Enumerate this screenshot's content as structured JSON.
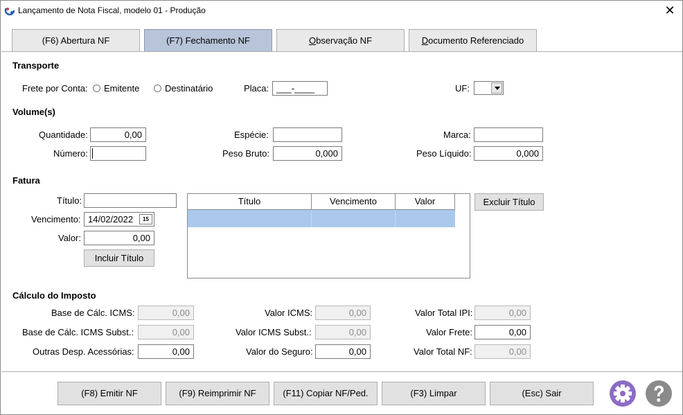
{
  "window": {
    "title": "Lançamento de Nota Fiscal, modelo 01 - Produção",
    "close": "✕"
  },
  "tabs": [
    {
      "label": "(F6) Abertura NF"
    },
    {
      "label": "(F7) Fechamento NF"
    },
    {
      "label_prefix": "",
      "label_underlined": "O",
      "label_rest": "bservação NF"
    },
    {
      "label_prefix": "",
      "label_underlined": "D",
      "label_rest": "ocumento Referenciado"
    }
  ],
  "transporte": {
    "title": "Transporte",
    "frete_label": "Frete por Conta:",
    "opt_emitente": "Emitente",
    "opt_destinatario": "Destinatário",
    "placa_label": "Placa:",
    "placa_value": "___-____",
    "uf_label": "UF:",
    "uf_value": ""
  },
  "volumes": {
    "title": "Volume(s)",
    "quantidade_label": "Quantidade:",
    "quantidade_value": "0,00",
    "numero_label": "Número:",
    "numero_value": "",
    "especie_label": "Espécie:",
    "especie_value": "",
    "peso_bruto_label": "Peso Bruto:",
    "peso_bruto_value": "0,000",
    "marca_label": "Marca:",
    "marca_value": "",
    "peso_liquido_label": "Peso Líquido:",
    "peso_liquido_value": "0,000"
  },
  "fatura": {
    "title": "Fatura",
    "titulo_label": "Título:",
    "titulo_value": "",
    "vencimento_label": "Vencimento:",
    "vencimento_value": "14/02/2022",
    "calendar_day": "15",
    "valor_label": "Valor:",
    "valor_value": "0,00",
    "incluir_btn": "Incluir Título",
    "excluir_btn": "Excluir Título",
    "grid_columns": [
      "Título",
      "Vencimento",
      "Valor"
    ]
  },
  "imposto": {
    "title": "Cálculo do Imposto",
    "base_icms_label": "Base de Cálc. ICMS:",
    "base_icms_value": "0,00",
    "base_icms_subst_label": "Base de Cálc. ICMS Subst.:",
    "base_icms_subst_value": "0,00",
    "outras_label": "Outras Desp. Acessórias:",
    "outras_value": "0,00",
    "valor_icms_label": "Valor ICMS:",
    "valor_icms_value": "0,00",
    "valor_icms_subst_label": "Valor ICMS Subst.:",
    "valor_icms_subst_value": "0,00",
    "valor_seguro_label": "Valor do Seguro:",
    "valor_seguro_value": "0,00",
    "valor_ipi_label": "Valor Total IPI:",
    "valor_ipi_value": "0,00",
    "valor_frete_label": "Valor Frete:",
    "valor_frete_value": "0,00",
    "valor_nf_label": "Valor Total NF:",
    "valor_nf_value": "0,00"
  },
  "footer": {
    "emitir": "(F8) Emitir NF",
    "reimprimir": "(F9) Reimprimir NF",
    "copiar": "(F11) Copiar NF/Ped.",
    "limpar": "(F3) Limpar",
    "sair": "(Esc) Sair"
  },
  "colors": {
    "accent": "#8c6cc4",
    "help": "#8a8a8a",
    "tab_active": "#b7c4d9",
    "grid_selection": "#a9c8ec"
  }
}
